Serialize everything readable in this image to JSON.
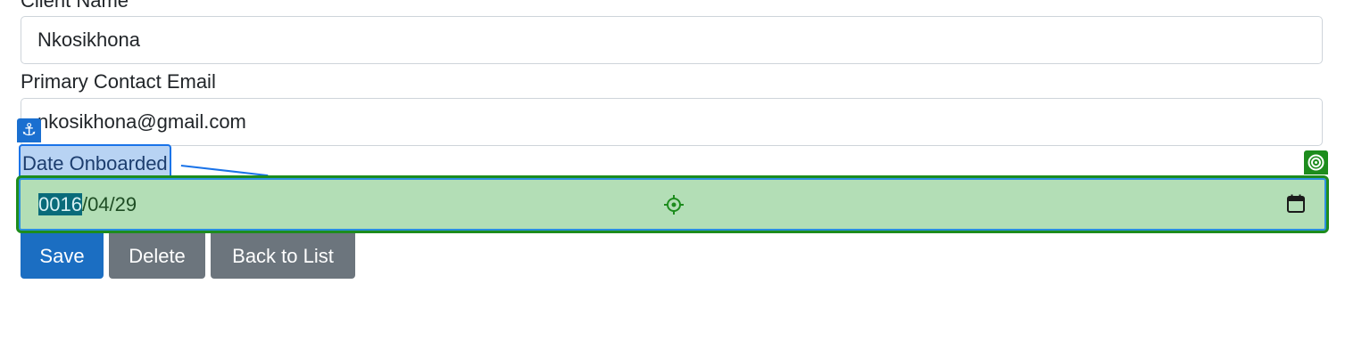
{
  "form": {
    "client_name": {
      "label": "Client Name",
      "value": "Nkosikhona"
    },
    "primary_contact_email": {
      "label": "Primary Contact Email",
      "value": "nkosikhona@gmail.com"
    },
    "date_onboarded": {
      "label": "Date Onboarded",
      "year_segment": "0016",
      "rest": "/04/29"
    }
  },
  "buttons": {
    "save": "Save",
    "delete": "Delete",
    "back": "Back to List"
  },
  "icons": {
    "anchor": "anchor-icon",
    "target": "target-icon",
    "crosshair": "crosshair-icon",
    "calendar": "calendar-icon"
  },
  "colors": {
    "primary": "#1b6ec2",
    "secondary": "#6c757d",
    "highlight_green": "#b3deb6",
    "highlight_blue": "#b8d3f3"
  }
}
